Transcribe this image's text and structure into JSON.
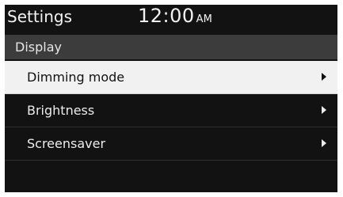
{
  "status_bar": {
    "title": "Settings",
    "time": "12:00",
    "ampm": "AM"
  },
  "section": {
    "title": "Display"
  },
  "menu": {
    "items": [
      {
        "label": "Dimming mode",
        "selected": true
      },
      {
        "label": "Brightness",
        "selected": false
      },
      {
        "label": "Screensaver",
        "selected": false
      }
    ]
  },
  "colors": {
    "screen_bg": "#121212",
    "section_bg": "#3c3c3c",
    "selected_bg": "#f1f1f1",
    "text_light": "#ececec",
    "text_dark": "#111111"
  },
  "icons": {
    "chevron": "chevron-right-icon"
  }
}
